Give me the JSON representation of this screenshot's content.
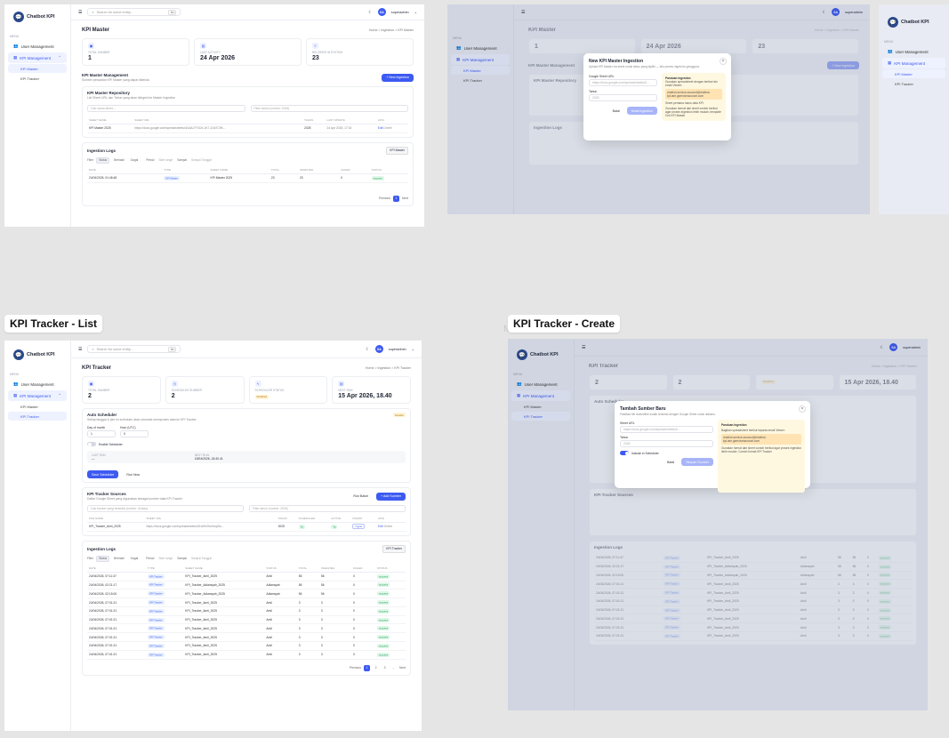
{
  "app": {
    "name": "Chatbot KPI",
    "search_placeholder": "Search for some entity...",
    "search_kbd": "⌘K",
    "user_initials": "SA",
    "user_name": "superadmin"
  },
  "sidebar": {
    "section": "MENU",
    "items": [
      {
        "label": "User Management"
      },
      {
        "label": "KPI Management"
      }
    ],
    "sub": [
      {
        "label": "KPI Master"
      },
      {
        "label": "KPI Tracker"
      }
    ]
  },
  "master": {
    "title": "KPI Master",
    "breadcrumb": "Home  >  Ingestion  >  KPI Master",
    "stats": [
      {
        "label": "TOTAL SUMBER",
        "value": "1"
      },
      {
        "label": "LAST ACTIVITY",
        "value": "24 Apr 2026"
      },
      {
        "label": "RECORDS IN SYSTEM",
        "value": "23"
      }
    ],
    "mgmt_title": "KPI Master Management",
    "mgmt_sub": "Sumber pencarian KPI Master yang dapat dikelola",
    "new_btn": "+ New ingestion",
    "sources_title": "KPI Master Repository",
    "sources_sub": "List Sheet URL dan Tahun yang akan diingest ke Master Ingestion",
    "filter_sheet": "Cari nama sheet...",
    "filter_year": "Filter tahun (contoh: 2026)",
    "table_headers": [
      "SHEET NAME",
      "SHEET URL",
      "TAHUN",
      "LAST UPDATE",
      "AKSI"
    ],
    "rows": [
      {
        "name": "KPI Master 2025",
        "url": "https://docs.google.com/spreadsheets/d/1AAJTYD2x-1K7-1Gk7C9K...",
        "year": "2025",
        "updated": "24 Apr 2026, 17:15",
        "edit": "Edit",
        "delete": "Delete"
      }
    ],
    "logs_title": "Ingestion Logs",
    "logs_btn": "KPI Master",
    "filters": [
      "Filter",
      "Status",
      "Berhasil",
      "Gagal",
      "Period",
      "Start range",
      "Sampai",
      "Sampai Tanggal"
    ],
    "log_headers": [
      "Date",
      "Type",
      "Sheet Name",
      "Total",
      "Ingested",
      "Failed",
      "Status"
    ],
    "log_rows": [
      {
        "date": "24/04/2026, 01:46:48",
        "type": "KPI Master",
        "sheet": "KPI Master 2025",
        "total": "23",
        "ingested": "23",
        "failed": "0",
        "status": "success"
      }
    ],
    "pager": {
      "prev": "Previous",
      "page": "1",
      "next": "Next"
    }
  },
  "master_modal": {
    "title": "New KPI Master Ingestion",
    "subtitle": "Upload KPI Master via sheet untuk tahun yang dipilih — lalu proses ingest ke gengguna.",
    "url_label": "Google Sheet URL",
    "url_placeholder": "https://docs.google.com/spreadsheets/d/...",
    "year_label": "Tahun",
    "year_placeholder": "2026",
    "cancel": "Batal",
    "submit": "Mulai Ingestion",
    "hint_title": "Panduan Ingestion",
    "hint_1": "Gunakan spreadsheet dengan berikut izin email Viewer:",
    "hint_warn": "chatbot-service-account@chatbot-kpi.iam.gserviceaccount.com",
    "hint_2": "Sheet pertama harus data KPI.",
    "hint_3": "Gunakan format dari sheet contoh berikut agar proses ingestion lebih mudah, template Cek KPI Master"
  },
  "tracker": {
    "tag": "KPI Tracker - List",
    "title": "KPI Tracker",
    "breadcrumb": "Home  >  Ingestion  >  KPI Tracker",
    "stats": [
      {
        "label": "TOTAL SUMBER",
        "value": "2"
      },
      {
        "label": "SCHEDULED SUMBER",
        "value": "2"
      },
      {
        "label": "SCHEDULER STATUS",
        "value": "",
        "badge": "Disabled"
      },
      {
        "label": "NEXT RUN",
        "value": "15 Apr 2026, 18.40"
      }
    ],
    "scheduler_title": "Auto Scheduler",
    "scheduler_sub": "Setiap tanggal & jam ini scheduler akan otomatis memproses data ke KPI Tracker.",
    "scheduler_badge": "Disable",
    "day_label": "Day of month",
    "day_value": "1",
    "hour_label": "Hour (UTC)",
    "hour_value": "0",
    "enable_label": "Enable Scheduler",
    "last_run_label": "Last Run",
    "last_run_value": "—",
    "next_run_label": "Next Run",
    "next_run_value": "15/04/2026, 18.40.41",
    "save_btn": "Save Scheduler",
    "run_btn": "Run Now",
    "sources_title": "KPI Tracker Sources",
    "sources_sub": "Daftar Google Sheet yang digunakan sebagai sumber data KPI Tracker",
    "run_batch": "Run Batch",
    "add_source": "+ Add Sumber",
    "filter_sheet": "Cari tracker yang tersedia (contoh: di atas)",
    "filter_year": "Filter tahun (contoh: 2026)",
    "source_headers": [
      "FILE NAME",
      "SHEET URL",
      "TAHUN",
      "SCHEDULED",
      "ACTIVE",
      "INGEST",
      "AKSI"
    ],
    "source_rows": [
      {
        "name": "KPI_Tracker_Amil_2025",
        "url": "https://docs.google.com/spreadsheets/d/1w9m7bnHoq/8o...",
        "year": "2025",
        "scheduled": "Ya",
        "active": "Ya",
        "ingest": "Ingest",
        "edit": "Edit",
        "delete": "Delete"
      }
    ],
    "logs_title": "Ingestion Logs",
    "logs_btn": "KPI Tracker",
    "filters": [
      "Filter",
      "Status",
      "Berhasil",
      "Gagal",
      "Period",
      "Start range",
      "Sampai",
      "Sampai Tanggal"
    ],
    "log_headers": [
      "Date",
      "Type",
      "Sheet Name",
      "Status",
      "Total",
      "Ingested",
      "Failed",
      "Status"
    ],
    "log_rows": [
      {
        "date": "24/04/2026, 07:11:47",
        "type": "KPI Tracker",
        "sheet": "KPI_Tracker_Amil_2025",
        "src": "Amil",
        "total": "56",
        "ingested": "56",
        "failed": "0",
        "status": "success"
      },
      {
        "date": "24/04/2026, 02:21:17",
        "type": "KPI Tracker",
        "sheet": "KPI_Tracker_Adiansyah_2025",
        "src": "Adiansyah",
        "total": "56",
        "ingested": "56",
        "failed": "0",
        "status": "success"
      },
      {
        "date": "24/04/2026, 02:15:00",
        "type": "KPI Tracker",
        "sheet": "KPI_Tracker_Adiansyah_2025",
        "src": "Adiansyah",
        "total": "56",
        "ingested": "56",
        "failed": "0",
        "status": "success"
      },
      {
        "date": "24/04/2026, 07:01:21",
        "type": "KPI Tracker",
        "sheet": "KPI_Tracker_Amil_2025",
        "src": "Amil",
        "total": "3",
        "ingested": "3",
        "failed": "0",
        "status": "success"
      },
      {
        "date": "24/04/2026, 07:01:21",
        "type": "KPI Tracker",
        "sheet": "KPI_Tracker_Amil_2025",
        "src": "Amil",
        "total": "3",
        "ingested": "3",
        "failed": "0",
        "status": "success"
      },
      {
        "date": "24/04/2026, 07:01:21",
        "type": "KPI Tracker",
        "sheet": "KPI_Tracker_Amil_2025",
        "src": "Amil",
        "total": "3",
        "ingested": "3",
        "failed": "0",
        "status": "success"
      },
      {
        "date": "24/04/2026, 07:01:21",
        "type": "KPI Tracker",
        "sheet": "KPI_Tracker_Amil_2025",
        "src": "Amil",
        "total": "3",
        "ingested": "3",
        "failed": "0",
        "status": "success"
      },
      {
        "date": "24/04/2026, 07:01:21",
        "type": "KPI Tracker",
        "sheet": "KPI_Tracker_Amil_2025",
        "src": "Amil",
        "total": "3",
        "ingested": "3",
        "failed": "0",
        "status": "success"
      },
      {
        "date": "24/04/2026, 07:01:21",
        "type": "KPI Tracker",
        "sheet": "KPI_Tracker_Amil_2025",
        "src": "Amil",
        "total": "3",
        "ingested": "3",
        "failed": "0",
        "status": "success"
      },
      {
        "date": "24/04/2026, 07:01:21",
        "type": "KPI Tracker",
        "sheet": "KPI_Tracker_Amil_2025",
        "src": "Amil",
        "total": "3",
        "ingested": "3",
        "failed": "0",
        "status": "success"
      }
    ],
    "pager": {
      "prev": "Previous",
      "pages": [
        "1",
        "2",
        "3",
        "..."
      ],
      "next": "Next"
    }
  },
  "tracker_create": {
    "tag": "KPI Tracker - Create",
    "ghost": "Master",
    "modal_title": "Tambah Sumber Baru",
    "modal_sub": "Pastikan file sharedlink sudah tersedia dengan Google Sheet untuk diakses.",
    "url_label": "Sheet URL",
    "url_placeholder": "https://docs.google.com/spreadsheets/d/...",
    "year_label": "Tahun",
    "year_placeholder": "2026",
    "toggle_label": "Include in Scheduler",
    "cancel": "Batal",
    "submit": "Simpan Sumber",
    "hint_title": "Panduan Ingestion",
    "hint_1": "Bagikan spreadsheet berikut kepada email Viewer:",
    "hint_warn": "chatbot-service-account@chatbot-kpi.iam.gserviceaccount.com",
    "hint_2": "Gunakan format dari sheet contoh berikut agar proses ingestion lebih mudah. Contoh format KPI Tracker"
  }
}
